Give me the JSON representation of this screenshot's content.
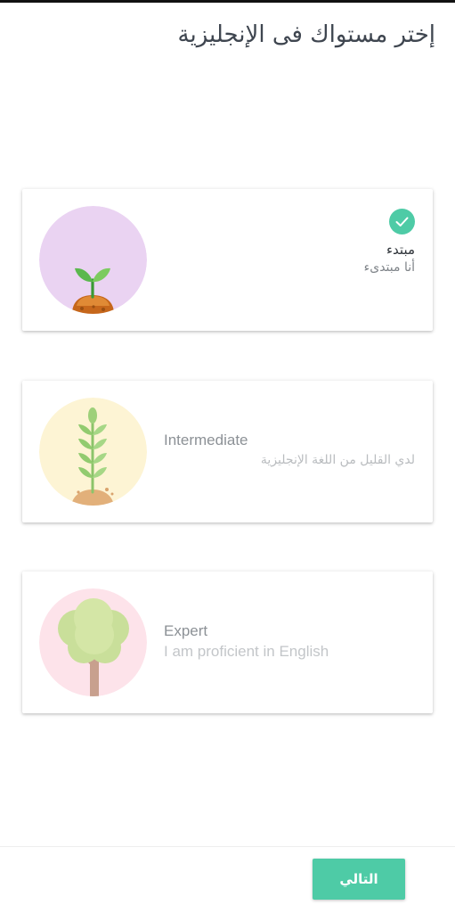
{
  "page": {
    "title": "إختر مستواك فى الإنجليزية"
  },
  "levels": [
    {
      "title": "مبتدء",
      "subtitle": "أنا مبتدىء",
      "selected": true,
      "icon": "sprout-icon",
      "circle_color": "#ead3f2"
    },
    {
      "title": "Intermediate",
      "subtitle": "لدي القليل من اللغة الإنجليزية",
      "selected": false,
      "icon": "wheat-plant-icon",
      "circle_color": "#fdf4d4"
    },
    {
      "title": "Expert",
      "subtitle": "I am proficient in English",
      "selected": false,
      "icon": "tree-icon",
      "circle_color": "#fde3ea"
    }
  ],
  "footer": {
    "next_label": "التالي"
  },
  "colors": {
    "accent": "#4ecba6",
    "title_text": "#3f4650"
  }
}
